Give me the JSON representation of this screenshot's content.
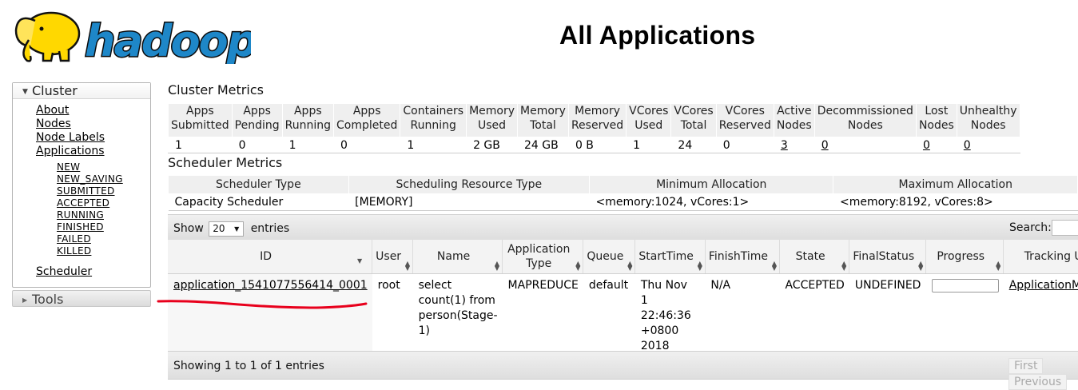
{
  "header": {
    "logo_text": "hadoop",
    "page_title": "All Applications"
  },
  "sidebar": {
    "cluster_label": "Cluster",
    "links": [
      "About",
      "Nodes",
      "Node Labels",
      "Applications"
    ],
    "app_states": [
      "NEW",
      "NEW_SAVING",
      "SUBMITTED",
      "ACCEPTED",
      "RUNNING",
      "FINISHED",
      "FAILED",
      "KILLED"
    ],
    "scheduler_label": "Scheduler",
    "tools_label": "Tools"
  },
  "cluster_metrics": {
    "title": "Cluster Metrics",
    "headers": [
      [
        "Apps",
        "Submitted"
      ],
      [
        "Apps",
        "Pending"
      ],
      [
        "Apps",
        "Running"
      ],
      [
        "Apps",
        "Completed"
      ],
      [
        "Containers",
        "Running"
      ],
      [
        "Memory",
        "Used"
      ],
      [
        "Memory",
        "Total"
      ],
      [
        "Memory",
        "Reserved"
      ],
      [
        "VCores",
        "Used"
      ],
      [
        "VCores",
        "Total"
      ],
      [
        "VCores",
        "Reserved"
      ],
      [
        "Active",
        "Nodes"
      ],
      [
        "Decommissioned",
        "Nodes"
      ],
      [
        "Lost",
        "Nodes"
      ],
      [
        "Unhealthy",
        "Nodes"
      ]
    ],
    "values": [
      "1",
      "0",
      "1",
      "0",
      "1",
      "2 GB",
      "24 GB",
      "0 B",
      "1",
      "24",
      "0",
      "3",
      "0",
      "0",
      "0"
    ]
  },
  "scheduler_metrics": {
    "title": "Scheduler Metrics",
    "headers": [
      "Scheduler Type",
      "Scheduling Resource Type",
      "Minimum Allocation",
      "Maximum Allocation"
    ],
    "values": [
      "Capacity Scheduler",
      "[MEMORY]",
      "<memory:1024, vCores:1>",
      "<memory:8192, vCores:8>"
    ]
  },
  "apps": {
    "show_label": "Show",
    "entries_label": "entries",
    "page_size": "20",
    "search_label": "Search:",
    "columns": [
      [
        "ID"
      ],
      [
        "User"
      ],
      [
        "Name"
      ],
      [
        "Application",
        "Type"
      ],
      [
        "Queue"
      ],
      [
        "StartTime"
      ],
      [
        "FinishTime"
      ],
      [
        "State"
      ],
      [
        "FinalStatus"
      ],
      [
        "Progress"
      ],
      [
        "Tracking UI"
      ]
    ],
    "rows": [
      {
        "id": "application_1541077556414_0001",
        "user": "root",
        "name": [
          "select",
          "count(1) from",
          "person(Stage-",
          "1)"
        ],
        "type": "MAPREDUCE",
        "queue": "default",
        "start": [
          "Thu Nov",
          "1",
          "22:46:36",
          "+0800",
          "2018"
        ],
        "finish": "N/A",
        "state": "ACCEPTED",
        "final_status": "UNDEFINED",
        "progress": 0,
        "tracking": "ApplicationMaster"
      }
    ],
    "showing_text": "Showing 1 to 1 of 1 entries",
    "pager": [
      "First",
      "Previous"
    ]
  },
  "colors": {
    "annotation": "#e8001c",
    "logo_yellow": "#ffd800",
    "logo_blue": "#1e87c8"
  }
}
